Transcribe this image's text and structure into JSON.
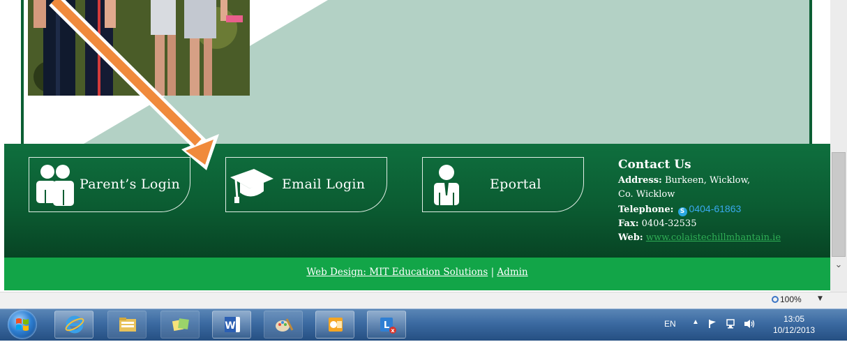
{
  "footer": {
    "buttons": [
      {
        "label": "Parent’s Login",
        "icon": "parents-icon"
      },
      {
        "label": "Email Login",
        "icon": "graduation-cap-icon"
      },
      {
        "label": "Eportal",
        "icon": "person-icon"
      }
    ],
    "contact": {
      "title": "Contact Us",
      "address_label": "Address:",
      "address_line1": "Burkeen, Wicklow,",
      "address_line2": "Co. Wicklow",
      "telephone_label": "Telephone:",
      "telephone": "0404-61863",
      "fax_label": "Fax:",
      "fax": "0404-32535",
      "web_label": "Web:",
      "web": "www.colaistechillmhantain.ie"
    },
    "credit": {
      "design": "Web Design: MIT Education Solutions",
      "separator": "|",
      "admin": "Admin"
    }
  },
  "statusbar": {
    "zoom": "100%"
  },
  "taskbar": {
    "apps": [
      "internet-explorer-icon",
      "file-explorer-icon",
      "sticky-notes-icon",
      "word-icon",
      "paint-icon",
      "outlook-icon",
      "lync-icon"
    ],
    "language": "EN",
    "time": "13:05",
    "date": "10/12/2013"
  },
  "colors": {
    "footer_green": "#0b5c32",
    "credit_green": "#12a548",
    "accent_arrow": "#f08a3c"
  }
}
